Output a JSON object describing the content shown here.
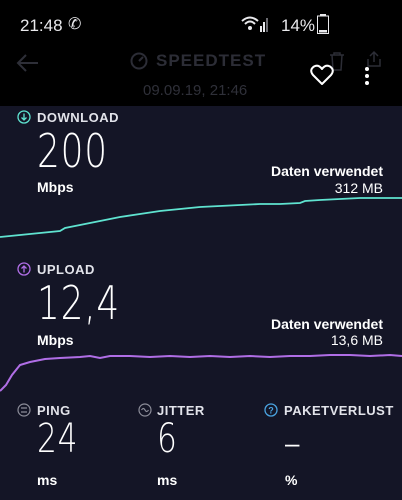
{
  "status_bar": {
    "time": "21:48",
    "battery": "14%"
  },
  "header": {
    "brand": "SPEEDTEST",
    "datetime": "09.09.19, 21:46"
  },
  "download": {
    "label": "DOWNLOAD",
    "value": "200",
    "unit": "Mbps",
    "data_used_label": "Daten verwendet",
    "data_used_value": "312 MB",
    "color": "#5fe3d0"
  },
  "upload": {
    "label": "UPLOAD",
    "value": "12,4",
    "unit": "Mbps",
    "data_used_label": "Daten verwendet",
    "data_used_value": "13,6 MB",
    "color": "#b06ee6"
  },
  "ping": {
    "label": "PING",
    "value": "24",
    "unit": "ms"
  },
  "jitter": {
    "label": "JITTER",
    "value": "6",
    "unit": "ms"
  },
  "packet_loss": {
    "label": "PAKETVERLUST",
    "value": "–",
    "unit": "%",
    "icon_color": "#4aa3e0"
  },
  "icons": [
    "back-arrow-icon",
    "speedtest-gauge-icon",
    "heart-icon",
    "trash-icon",
    "more-vert-icon",
    "share-icon",
    "download-icon",
    "upload-icon",
    "ping-icon",
    "jitter-icon",
    "help-icon"
  ]
}
